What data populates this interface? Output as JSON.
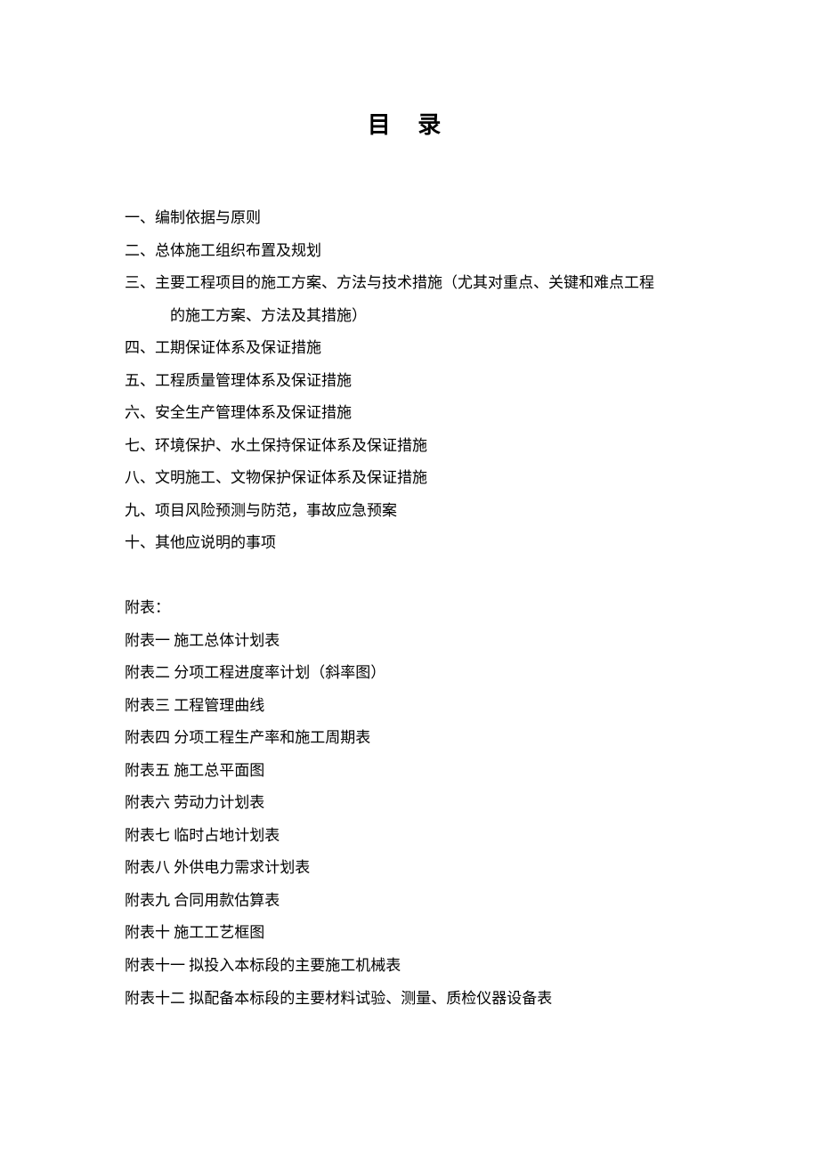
{
  "title": "目  录",
  "toc": {
    "item1": "一、编制依据与原则",
    "item2": "二、总体施工组织布置及规划",
    "item3a": "三、主要工程项目的施工方案、方法与技术措施（尤其对重点、关键和难点工程",
    "item3b": "的施工方案、方法及其措施）",
    "item4": "四、工期保证体系及保证措施",
    "item5": "五、工程质量管理体系及保证措施",
    "item6": "六、安全生产管理体系及保证措施",
    "item7": "七、环境保护、水土保持保证体系及保证措施",
    "item8": "八、文明施工、文物保护保证体系及保证措施",
    "item9": "九、项目风险预测与防范，事故应急预案",
    "item10": "十、其他应说明的事项"
  },
  "appendix": {
    "header": "附表：",
    "item1": "附表一  施工总体计划表",
    "item2": "附表二  分项工程进度率计划（斜率图）",
    "item3": "附表三 工程管理曲线",
    "item4": "附表四  分项工程生产率和施工周期表",
    "item5": "附表五  施工总平面图",
    "item6": "附表六  劳动力计划表",
    "item7": "附表七  临时占地计划表",
    "item8": "附表八  外供电力需求计划表",
    "item9": "附表九  合同用款估算表",
    "item10": "附表十  施工工艺框图",
    "item11": "附表十一  拟投入本标段的主要施工机械表",
    "item12": "附表十二    拟配备本标段的主要材料试验、测量、质检仪器设备表"
  }
}
